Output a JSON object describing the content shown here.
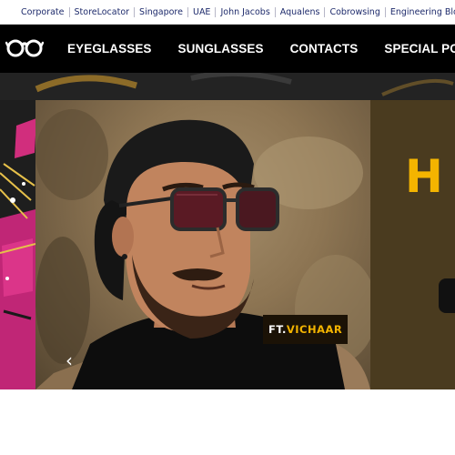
{
  "top_links": [
    "Corporate",
    "StoreLocator",
    "Singapore",
    "UAE",
    "John Jacobs",
    "Aqualens",
    "Cobrowsing",
    "Engineering Blog"
  ],
  "nav": {
    "logo_icon": "eyeglasses-logo-icon",
    "items": [
      "EYEGLASSES",
      "SUNGLASSES",
      "CONTACTS",
      "SPECIAL POWER"
    ]
  },
  "hero": {
    "tag_prefix": "FT.",
    "tag_name": "VICHAAR",
    "next_slide_heading": "H",
    "prev_arrow_icon": "chevron-left-icon",
    "prev_arrow_glyph": "‹"
  },
  "colors": {
    "nav_background": "#000000",
    "link_text": "#1d2a6b",
    "accent_yellow": "#f4b400"
  }
}
